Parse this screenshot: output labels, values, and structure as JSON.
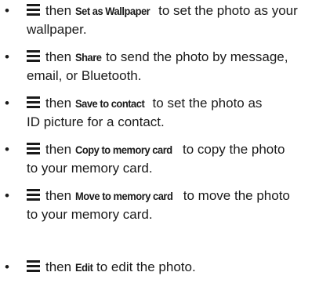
{
  "items": [
    {
      "bullet": "•",
      "icon": "menu-icon",
      "pre": "then",
      "command": "Set as Wallpaper",
      "post": "to set the photo as your",
      "line2": "wallpaper."
    },
    {
      "bullet": "•",
      "icon": "menu-icon",
      "pre": "then",
      "command": "Share",
      "post": "to send the photo by message,",
      "line2": "email, or Bluetooth."
    },
    {
      "bullet": "•",
      "icon": "menu-icon",
      "pre": "then",
      "command": "Save to contact",
      "post": "to set the photo as",
      "line2": "ID picture for a contact."
    },
    {
      "bullet": "•",
      "icon": "menu-icon",
      "pre": "then",
      "command": "Copy to memory card",
      "post": "to copy the photo",
      "line2": "to your memory card."
    },
    {
      "bullet": "•",
      "icon": "menu-icon",
      "pre": "then",
      "command": "Move to memory card",
      "post": "to move the photo",
      "line2": "to your memory card."
    },
    {
      "bullet": "•",
      "icon": "menu-icon",
      "pre": "then",
      "command": "Edit",
      "post": "to edit the photo.",
      "line2": ""
    }
  ]
}
